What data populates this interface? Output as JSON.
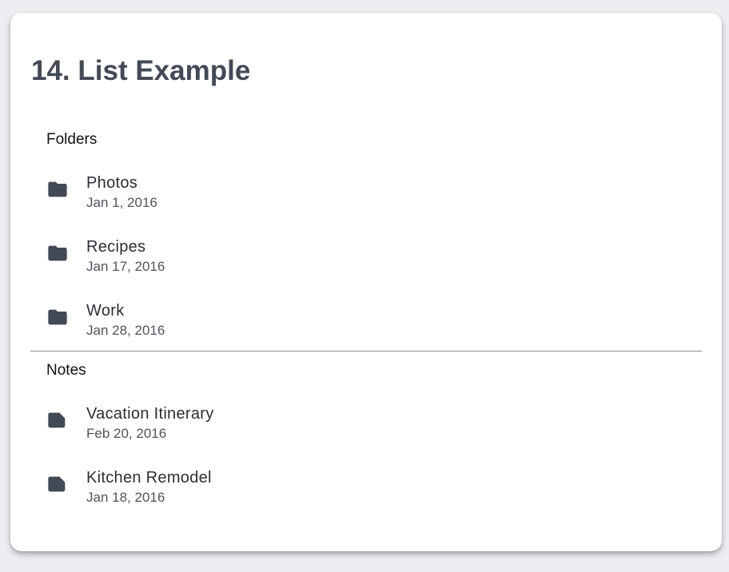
{
  "page": {
    "title": "14. List Example"
  },
  "sections": [
    {
      "subheader": "Folders",
      "items": [
        {
          "icon": "folder-icon",
          "primary": "Photos",
          "secondary": "Jan 1, 2016"
        },
        {
          "icon": "folder-icon",
          "primary": "Recipes",
          "secondary": "Jan 17, 2016"
        },
        {
          "icon": "folder-icon",
          "primary": "Work",
          "secondary": "Jan 28, 2016"
        }
      ]
    },
    {
      "subheader": "Notes",
      "items": [
        {
          "icon": "note-icon",
          "primary": "Vacation Itinerary",
          "secondary": "Feb 20, 2016"
        },
        {
          "icon": "note-icon",
          "primary": "Kitchen Remodel",
          "secondary": "Jan 18, 2016"
        }
      ]
    }
  ],
  "colors": {
    "icon": "#434a55",
    "title": "#434a55",
    "divider": "#8f8f8f"
  }
}
